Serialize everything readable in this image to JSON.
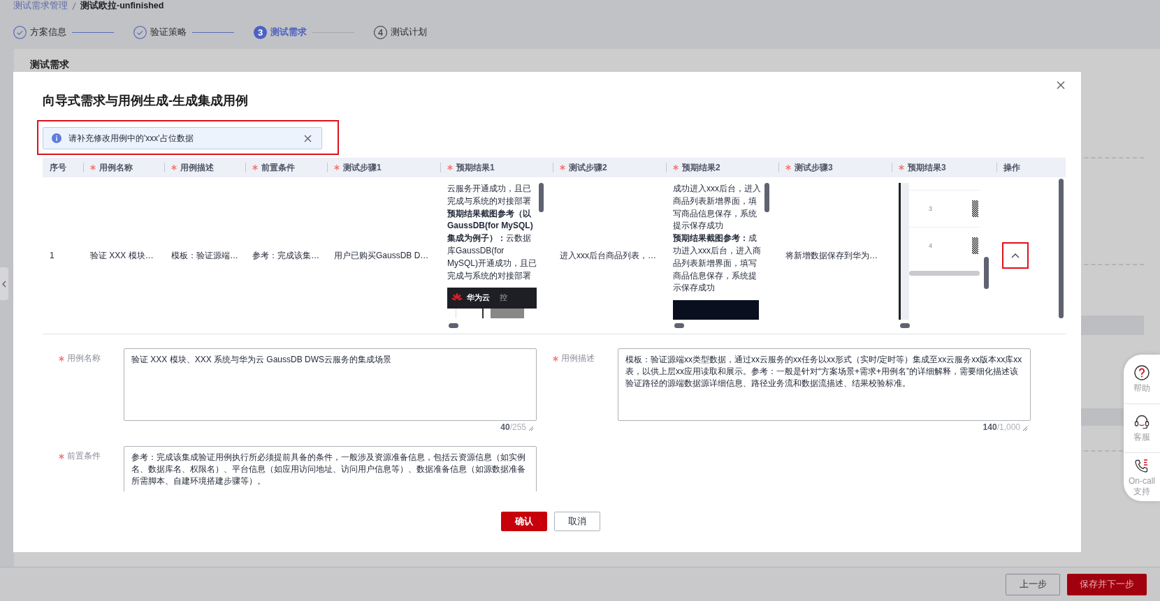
{
  "breadcrumb": [
    {
      "label": "测试需求管理",
      "kind": "link"
    },
    {
      "label": "测试欧拉-unfinished",
      "kind": "current"
    }
  ],
  "steps": [
    {
      "label": "方案信息",
      "completed": true,
      "selected": false
    },
    {
      "label": "验证策略",
      "completed": true,
      "selected": false
    },
    {
      "number": "3",
      "label": "测试需求",
      "completed": false,
      "selected": true
    },
    {
      "number": "4",
      "label": "测试计划",
      "completed": false,
      "selected": false
    }
  ],
  "section_title": "测试需求",
  "modal": {
    "title": "向导式需求与用例生成-生成集成用例",
    "alert": {
      "text": "请补充修改用例中的'xxx'占位数据",
      "highlighted": true
    },
    "table": {
      "columns": [
        {
          "label": "序号",
          "required": false
        },
        {
          "label": "用例名称",
          "required": true
        },
        {
          "label": "用例描述",
          "required": true
        },
        {
          "label": "前置条件",
          "required": true
        },
        {
          "label": "测试步骤1",
          "required": true
        },
        {
          "label": "预期结果1",
          "required": true
        },
        {
          "label": "测试步骤2",
          "required": true
        },
        {
          "label": "预期结果2",
          "required": true
        },
        {
          "label": "测试步骤3",
          "required": true
        },
        {
          "label": "预期结果3",
          "required": true
        },
        {
          "label": "操作",
          "required": false
        }
      ],
      "rows": [
        {
          "cells": [
            {
              "kind": "text",
              "text": "1"
            },
            {
              "kind": "text",
              "text": "验证 XXX 模块…"
            },
            {
              "kind": "text",
              "text": "模板：验证源端…"
            },
            {
              "kind": "text",
              "text": "参考：完成该集…"
            },
            {
              "kind": "text",
              "text": "用户已购买GaussDB D…"
            },
            {
              "kind": "rich",
              "paragraphs": [
                "云服务开通成功，且已完成与系统的对接部署",
                "**预期结果截图参考（以GaussDB(for MySQL)集成为例子）：**云数据库GaussDB(for MySQL)开通成功，且已完成与系统的对接部署"
              ],
              "screenshot": {
                "kind": "console",
                "texts": [
                  "华为云",
                  "控"
                ]
              }
            },
            {
              "kind": "text",
              "text": "进入xxx后台商品列表，…"
            },
            {
              "kind": "rich",
              "paragraphs": [
                "成功进入xxx后台，进入商品列表新增界面，填写商品信息保存，系统提示保存成功",
                "**预期结果截图参考：**成功进入xxx后台，进入商品列表新增界面，填写商品信息保存，系统提示保存成功"
              ],
              "screenshot": {
                "kind": "dark"
              }
            },
            {
              "kind": "text",
              "text": "将新增数据保存到华为…"
            },
            {
              "kind": "thumbnail",
              "row_labels": [
                "3",
                "4"
              ]
            },
            {
              "kind": "action",
              "expanded": true,
              "highlighted": true
            }
          ]
        }
      ]
    },
    "fields": [
      {
        "label": "用例名称",
        "required": true,
        "value": "验证 XXX 模块、XXX 系统与华为云 GaussDB DWS云服务的集成场景",
        "counter": "**40**/255"
      },
      {
        "label": "用例描述",
        "required": true,
        "value": "模板：验证源端xx类型数据，通过xx云服务的xx任务以xx形式（实时/定时等）集成至xx云服务xx版本xx库xx表，以供上层xx应用读取和展示。参考：一般是针对“方案场景+需求+用例名”的详细解释，需要细化描述该验证路径的源端数据源详细信息、路径业务流和数据流描述、结果校验标准。",
        "counter": "**140**/1,000"
      },
      {
        "label": "前置条件",
        "required": true,
        "value": "参考：完成该集成验证用例执行所必须提前具备的条件，一般涉及资源准备信息，包括云资源信息（如实例名、数据库名、权限名）、平台信息（如应用访问地址、访问用户信息等）、数据准备信息（如源数据准备所需脚本、自建环境搭建步骤等）。"
      }
    ],
    "buttons": [
      {
        "label": "确认",
        "kind": "primary"
      },
      {
        "label": "取消",
        "kind": "secondary"
      }
    ]
  },
  "footer_buttons": [
    {
      "label": "上一步",
      "kind": "secondary"
    },
    {
      "label": "保存并下一步",
      "kind": "primary"
    }
  ],
  "help_panel": [
    {
      "kind": "help",
      "label": "帮助"
    },
    {
      "kind": "service",
      "label": "客服"
    },
    {
      "kind": "oncall",
      "label": "On-call 支持"
    }
  ]
}
